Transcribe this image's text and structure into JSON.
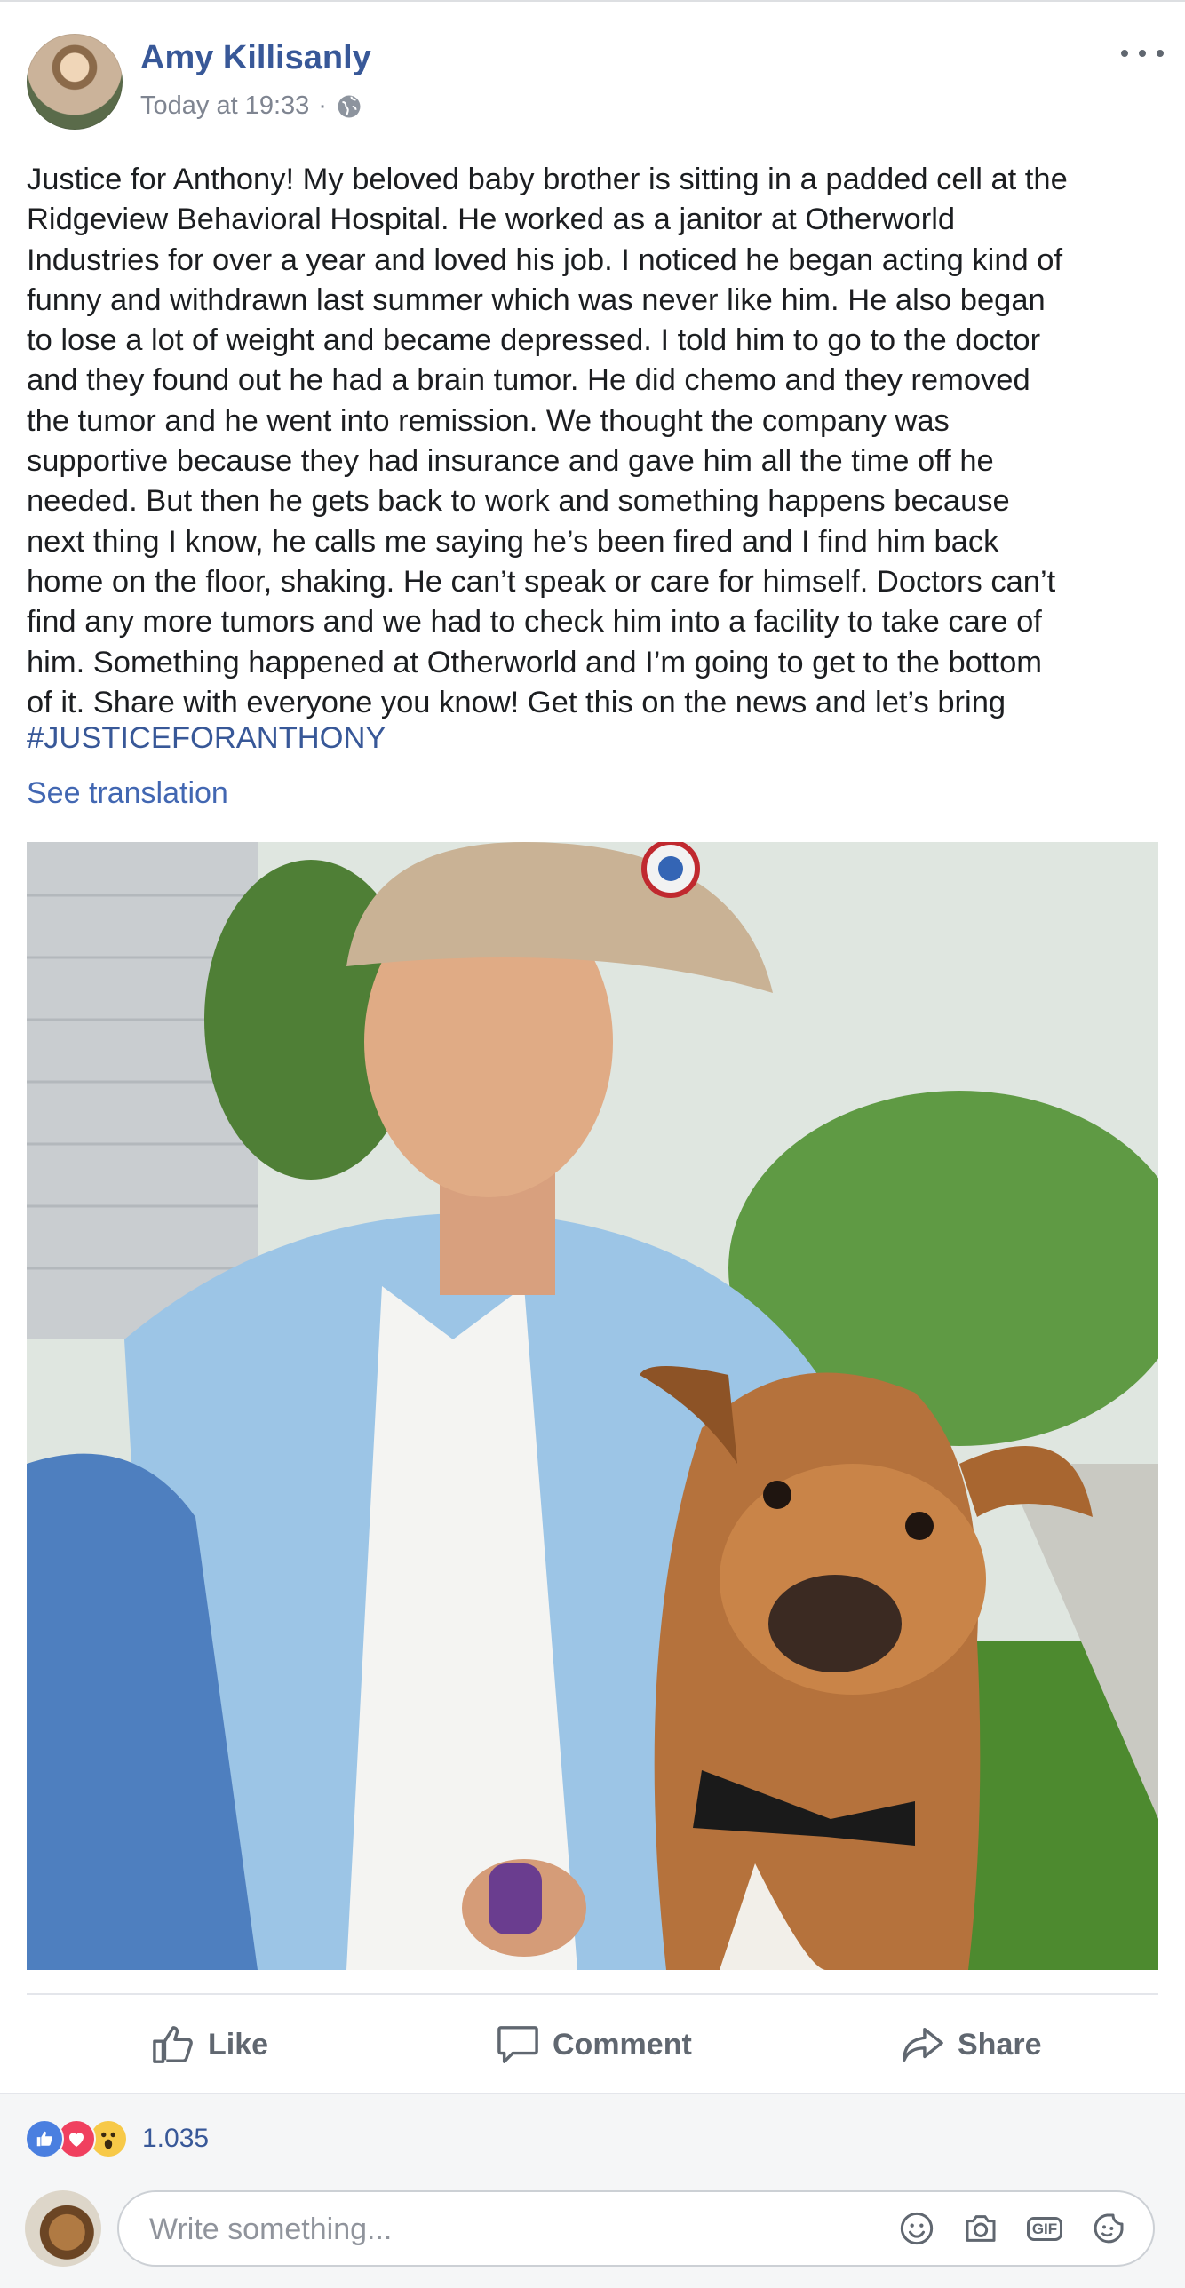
{
  "post": {
    "author": "Amy Killisanly",
    "time": "Today at 19:33",
    "separator": "·",
    "audience_icon": "globe-icon",
    "more_icon": "more-horizontal-icon",
    "text_lines": [
      "Justice for Anthony! My beloved baby brother is sitting in a padded cell at the",
      "Ridgeview Behavioral Hospital. He worked as a janitor at Otherworld",
      "Industries for over a year and loved his job. I noticed he began acting kind of",
      "funny and withdrawn last summer which was never like him. He also began",
      "to lose a lot of weight and became depressed. I told him to go to the doctor",
      "and they found out he had a brain tumor. He did chemo and they removed",
      "the tumor and he went into remission. We thought the company was",
      "supportive because they had insurance and gave him all the time off he",
      "needed. But then he gets back to work and something happens because",
      "next thing I know, he calls me saying he’s been fired and I find him back",
      "home on the floor, shaking. He can’t speak or care for himself. Doctors can’t",
      "find any more tumors and we had to check him into a facility to take care of",
      "him. Something happened at Otherworld and I’m going to get to the bottom",
      "of it. Share with everyone you know! Get this on the news and let’s bring"
    ],
    "hashtag": "#JUSTICEFORANTHONY",
    "see_translation": "See translation"
  },
  "actions": {
    "like": "Like",
    "comment": "Comment",
    "share": "Share"
  },
  "reactions": {
    "types": [
      "like",
      "love",
      "wow"
    ],
    "count": "1.035"
  },
  "composer": {
    "placeholder": "Write something...",
    "icons": [
      "emoji-icon",
      "camera-icon",
      "gif-icon",
      "sticker-icon"
    ],
    "gif_label": "GIF"
  },
  "colors": {
    "link": "#385898",
    "text": "#1c1e21",
    "muted": "#606770",
    "like_blue": "#4a7fe0",
    "love_red": "#f0405f",
    "wow_yellow": "#f7c948"
  }
}
